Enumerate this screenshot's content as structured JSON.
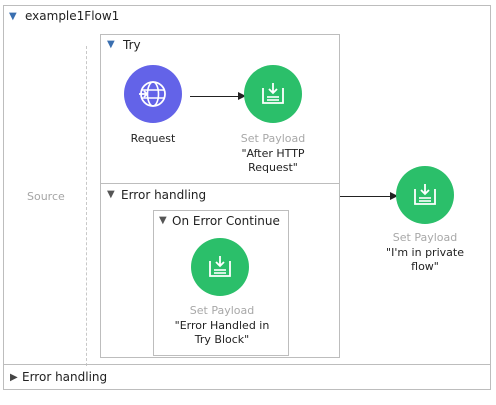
{
  "flow": {
    "title": "example1Flow1",
    "source_label": "Source"
  },
  "try_scope": {
    "label": "Try",
    "error_handling_label": "Error handling",
    "on_error_continue_label": "On Error Continue"
  },
  "nodes": {
    "request": {
      "icon": "globe-listener-icon",
      "type": "Request",
      "description": ""
    },
    "set_payload_after": {
      "icon": "set-payload-icon",
      "type": "Set Payload",
      "description_line1": "\"After HTTP",
      "description_line2": "Request\""
    },
    "set_payload_error": {
      "icon": "set-payload-icon",
      "type": "Set Payload",
      "description_line1": "\"Error Handled in",
      "description_line2": "Try Block\""
    },
    "set_payload_private": {
      "icon": "set-payload-icon",
      "type": "Set Payload",
      "description_line1": "\"I'm in private",
      "description_line2": "flow\""
    }
  },
  "footer": {
    "error_handling_label": "Error handling"
  },
  "colors": {
    "listener": "#6363e8",
    "processor": "#2bbf6a",
    "border": "#bdbdbd",
    "muted_text": "#a8a8a8"
  }
}
